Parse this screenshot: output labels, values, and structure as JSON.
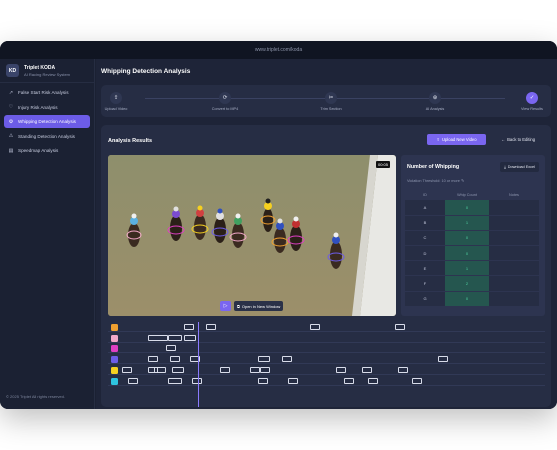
{
  "browser": {
    "url": "www.triplet.com/koda"
  },
  "brand": {
    "logo": "KD",
    "name": "Triplet KODA",
    "subtitle": "AI Racing Review System"
  },
  "sidebar": {
    "items": [
      {
        "label": "False Start Risk Analysis",
        "icon": "trend-icon",
        "glyph": "↗",
        "active": false
      },
      {
        "label": "Injury Risk Analysis",
        "icon": "heart-pulse-icon",
        "glyph": "♡",
        "active": false
      },
      {
        "label": "Whipping Detection Analysis",
        "icon": "whip-icon",
        "glyph": "⚙",
        "active": true
      },
      {
        "label": "Standing Detection Analysis",
        "icon": "alert-icon",
        "glyph": "⚠",
        "active": false
      },
      {
        "label": "Speedmap Analysis",
        "icon": "map-icon",
        "glyph": "▤",
        "active": false
      }
    ],
    "footer": "© 2025 Triplet All rights reserved."
  },
  "page": {
    "title": "Whipping Detection Analysis"
  },
  "steps": [
    {
      "label": "Upload Video",
      "icon": "upload-icon",
      "glyph": "⇪",
      "current": false
    },
    {
      "label": "Convert to MP4",
      "icon": "refresh-icon",
      "glyph": "⟳",
      "current": false
    },
    {
      "label": "Trim Section",
      "icon": "scissors-icon",
      "glyph": "✂",
      "current": false
    },
    {
      "label": "AI Analysis",
      "icon": "robot-icon",
      "glyph": "⊛",
      "current": false
    },
    {
      "label": "View Results",
      "icon": "check-icon",
      "glyph": "✓",
      "current": true
    }
  ],
  "results": {
    "title": "Analysis Results",
    "upload_label": "Upload New Video",
    "back_label": "Back to Editing",
    "video": {
      "timestamp": "00:05",
      "open_label": "Open in New Window"
    }
  },
  "whipping": {
    "title": "Number of Whipping",
    "download_label": "Download Excel",
    "threshold_label": "Violation Threshold:",
    "threshold_value": "10",
    "threshold_suffix": "or more",
    "columns": [
      "ID",
      "Whip Count",
      "Notes"
    ],
    "rows": [
      {
        "id": "A",
        "count": "0",
        "notes": ""
      },
      {
        "id": "B",
        "count": "1",
        "notes": ""
      },
      {
        "id": "C",
        "count": "0",
        "notes": ""
      },
      {
        "id": "D",
        "count": "0",
        "notes": ""
      },
      {
        "id": "E",
        "count": "1",
        "notes": ""
      },
      {
        "id": "F",
        "count": "2",
        "notes": ""
      },
      {
        "id": "G",
        "count": "0",
        "notes": ""
      }
    ]
  },
  "timeline": {
    "rows": [
      {
        "color": "#f0a030"
      },
      {
        "color": "#f2a8c8"
      },
      {
        "color": "#e03fc4"
      },
      {
        "color": "#6c5ce7"
      },
      {
        "color": "#f5d020"
      },
      {
        "color": "#2ec4e0"
      }
    ]
  }
}
